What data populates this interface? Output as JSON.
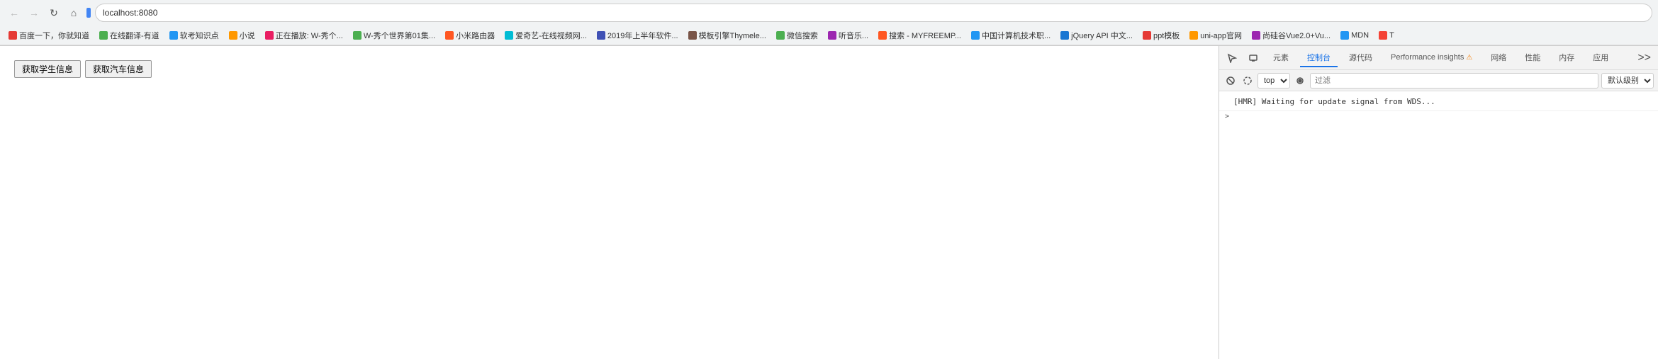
{
  "browser": {
    "address": "localhost:8080",
    "nav": {
      "back_title": "后退",
      "forward_title": "前进",
      "reload_title": "重新加载",
      "home_title": "主页",
      "info_icon": "ⓘ"
    },
    "bookmarks": [
      {
        "id": "bm1",
        "label": "百度一下，你就知道",
        "color": "#e53935"
      },
      {
        "id": "bm2",
        "label": "在线翻译-有道",
        "color": "#4caf50"
      },
      {
        "id": "bm3",
        "label": "软考知识点",
        "color": "#2196f3"
      },
      {
        "id": "bm4",
        "label": "小说",
        "color": "#ff9800"
      },
      {
        "id": "bm5",
        "label": "正在播放: W-秀个...",
        "color": "#e91e63"
      },
      {
        "id": "bm6",
        "label": "W-秀个世界第01集...",
        "color": "#4caf50"
      },
      {
        "id": "bm7",
        "label": "小米路由器",
        "color": "#ff5722"
      },
      {
        "id": "bm8",
        "label": "爱奇艺-在线视频网...",
        "color": "#00bcd4"
      },
      {
        "id": "bm9",
        "label": "2019年上半年软件...",
        "color": "#3f51b5"
      },
      {
        "id": "bm10",
        "label": "模板引擎Thymele...",
        "color": "#795548"
      },
      {
        "id": "bm11",
        "label": "微信搜索",
        "color": "#4caf50"
      },
      {
        "id": "bm12",
        "label": "听音乐...",
        "color": "#9c27b0"
      },
      {
        "id": "bm13",
        "label": "搜索 - MYFREEMP...",
        "color": "#ff5722"
      },
      {
        "id": "bm14",
        "label": "中国计算机技术职...",
        "color": "#2196f3"
      },
      {
        "id": "bm15",
        "label": "jQuery API 中文...",
        "color": "#1976d2"
      },
      {
        "id": "bm16",
        "label": "ppt模板",
        "color": "#e53935"
      },
      {
        "id": "bm17",
        "label": "uni-app官网",
        "color": "#ff9800"
      },
      {
        "id": "bm18",
        "label": "尚硅谷Vue2.0+Vu...",
        "color": "#9c27b0"
      },
      {
        "id": "bm19",
        "label": "MDN",
        "color": "#2196f3"
      },
      {
        "id": "bm20",
        "label": "T",
        "color": "#f44336"
      }
    ]
  },
  "page": {
    "button1_label": "获取学生信息",
    "button2_label": "获取汽车信息"
  },
  "devtools": {
    "tabs": [
      {
        "id": "elements",
        "label": "元素",
        "active": false
      },
      {
        "id": "console",
        "label": "控制台",
        "active": true
      },
      {
        "id": "sources",
        "label": "源代码",
        "active": false
      },
      {
        "id": "performance-insights",
        "label": "Performance insights",
        "active": false,
        "warning": true
      },
      {
        "id": "network",
        "label": "网络",
        "active": false
      },
      {
        "id": "performance",
        "label": "性能",
        "active": false
      },
      {
        "id": "memory",
        "label": "内存",
        "active": false
      },
      {
        "id": "application",
        "label": "应用",
        "active": false
      }
    ],
    "more_tabs_label": ">>",
    "console": {
      "context_select": "top",
      "filter_placeholder": "过滤",
      "level_select": "默认级别",
      "messages": [
        {
          "text": "[HMR] Waiting for update signal from WDS...",
          "type": "info"
        }
      ],
      "expand_symbol": ">"
    }
  }
}
